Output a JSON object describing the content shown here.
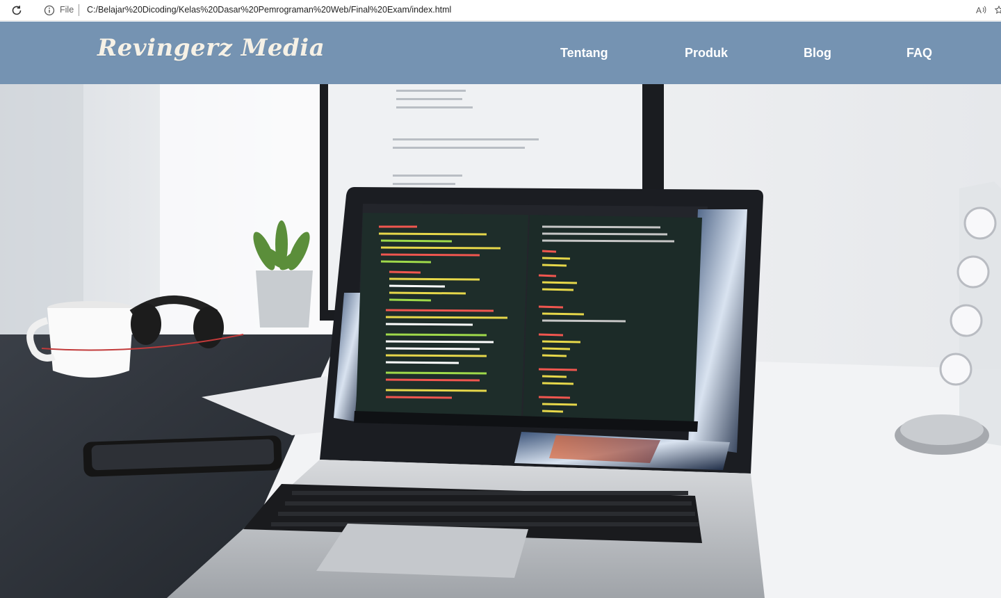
{
  "browser": {
    "scheme_label": "File",
    "url": "C:/Belajar%20Dicoding/Kelas%20Dasar%20Pemrograman%20Web/Final%20Exam/index.html",
    "icons": [
      "reload-icon",
      "info-icon",
      "read-aloud-icon",
      "favorite-icon"
    ]
  },
  "header": {
    "brand": "Revingerz Media",
    "background_color": "#7593b2",
    "text_color": "#ffffff",
    "nav": [
      {
        "label": "Tentang"
      },
      {
        "label": "Produk"
      },
      {
        "label": "Blog"
      },
      {
        "label": "FAQ"
      }
    ]
  },
  "hero": {
    "scene": "workspace-photo"
  }
}
